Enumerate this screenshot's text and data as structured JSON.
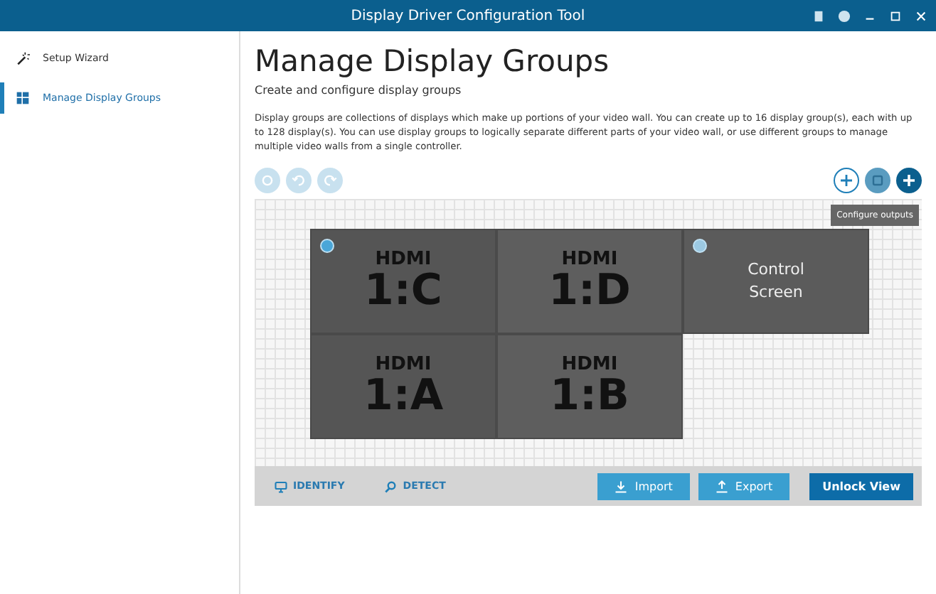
{
  "window": {
    "title": "Display Driver Configuration Tool"
  },
  "sidebar": {
    "items": [
      {
        "label": "Setup Wizard",
        "selected": false,
        "kind": "wizard"
      },
      {
        "label": "Manage Display Groups",
        "selected": true,
        "kind": "groups"
      }
    ]
  },
  "page": {
    "title": "Manage Display Groups",
    "subtitle": "Create and configure display groups",
    "description": "Display groups are collections of displays which make up portions of your video wall. You can create up to 16 display group(s), each with up to 128 display(s). You can use display groups to logically separate different parts of your video wall, or use different groups to manage multiple video walls from a single controller."
  },
  "history_buttons": [
    {
      "kind": "reset",
      "disabled": true
    },
    {
      "kind": "undo",
      "disabled": true
    },
    {
      "kind": "redo",
      "disabled": true
    }
  ],
  "tooltip": "Configure outputs",
  "displays": [
    {
      "kind": "output",
      "port": "HDMI",
      "id": "1:C",
      "marker": true
    },
    {
      "kind": "output",
      "port": "HDMI",
      "id": "1:D",
      "marker": false
    },
    {
      "kind": "output",
      "port": "HDMI",
      "id": "1:A",
      "marker": false
    },
    {
      "kind": "output",
      "port": "HDMI",
      "id": "1:B",
      "marker": false
    }
  ],
  "control_screen": {
    "label": "Control Screen"
  },
  "footer": {
    "links": [
      {
        "label": "IDENTIFY",
        "kind": "identify"
      },
      {
        "label": "DETECT",
        "kind": "detect"
      }
    ],
    "buttons": [
      {
        "label": "Import",
        "kind": "import"
      },
      {
        "label": "Export",
        "kind": "export"
      },
      {
        "label": "Unlock View",
        "kind": "primary"
      }
    ]
  }
}
